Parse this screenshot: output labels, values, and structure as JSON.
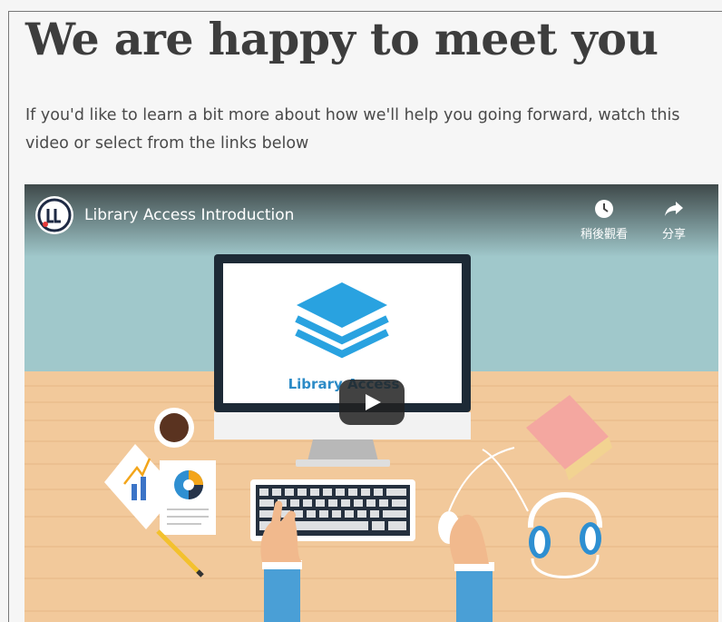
{
  "page": {
    "heading": "We are happy to meet you",
    "intro": "If you'd like to learn a bit more about how we'll help you going forward, watch this video or select from the links below"
  },
  "video": {
    "title": "Library Access Introduction",
    "channel_logo_text": "LL",
    "watch_later_label": "稍後觀看",
    "share_label": "分享",
    "screen_logo_text": "Library Access",
    "icons": {
      "watch_later": "clock-icon",
      "share": "share-arrow-icon",
      "play": "play-icon"
    },
    "colors": {
      "wall": "#a3c9cc",
      "desk": "#f3c99a",
      "logo_blue": "#29a2e0"
    }
  }
}
